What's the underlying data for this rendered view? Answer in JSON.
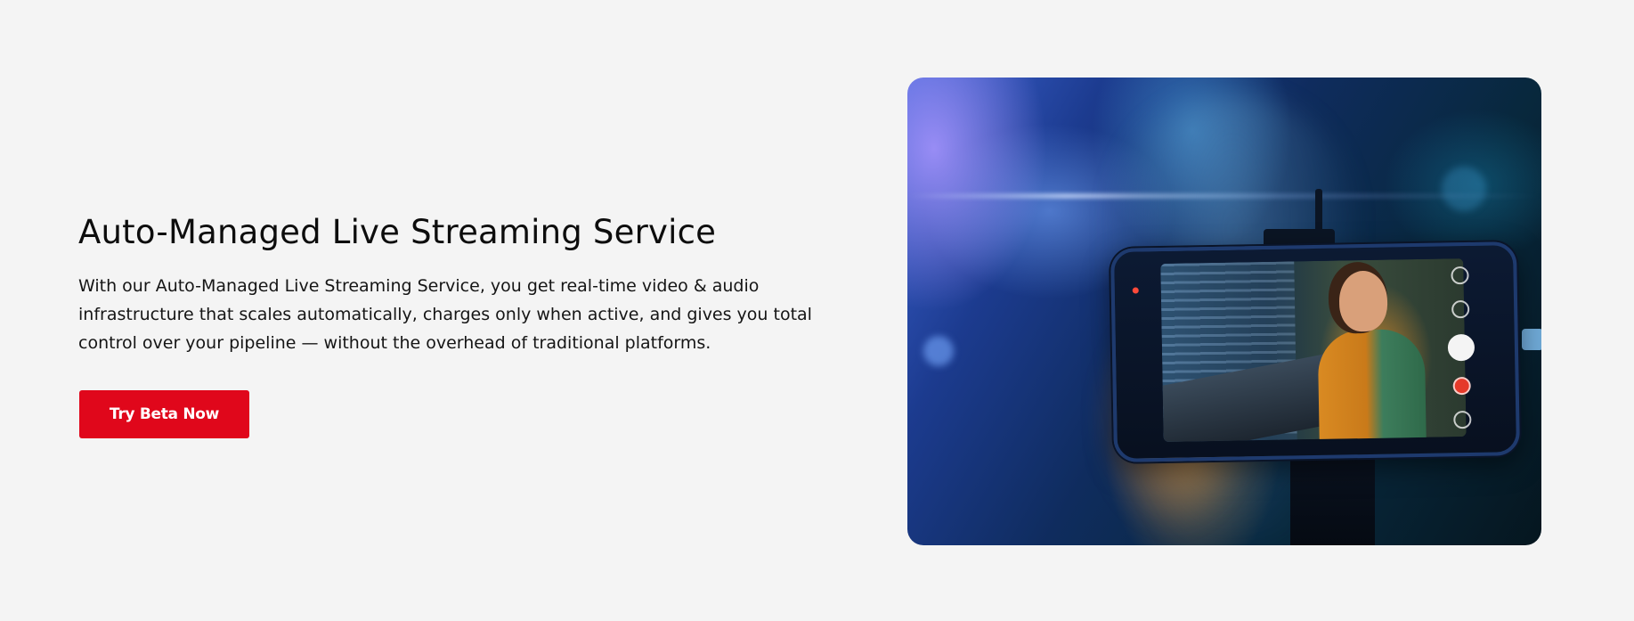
{
  "hero": {
    "title": "Auto-Managed Live Streaming Service",
    "description": "With our Auto-Managed Live Streaming Service, you get real-time video & audio infrastructure that scales automatically, charges only when active, and gives you total control over your pipeline — without the overhead of traditional platforms.",
    "cta_label": "Try Beta Now",
    "cta_color": "#e0071b",
    "background_color": "#f4f4f4",
    "image_subject": "streamer-on-smartphone-camera-illustration"
  }
}
